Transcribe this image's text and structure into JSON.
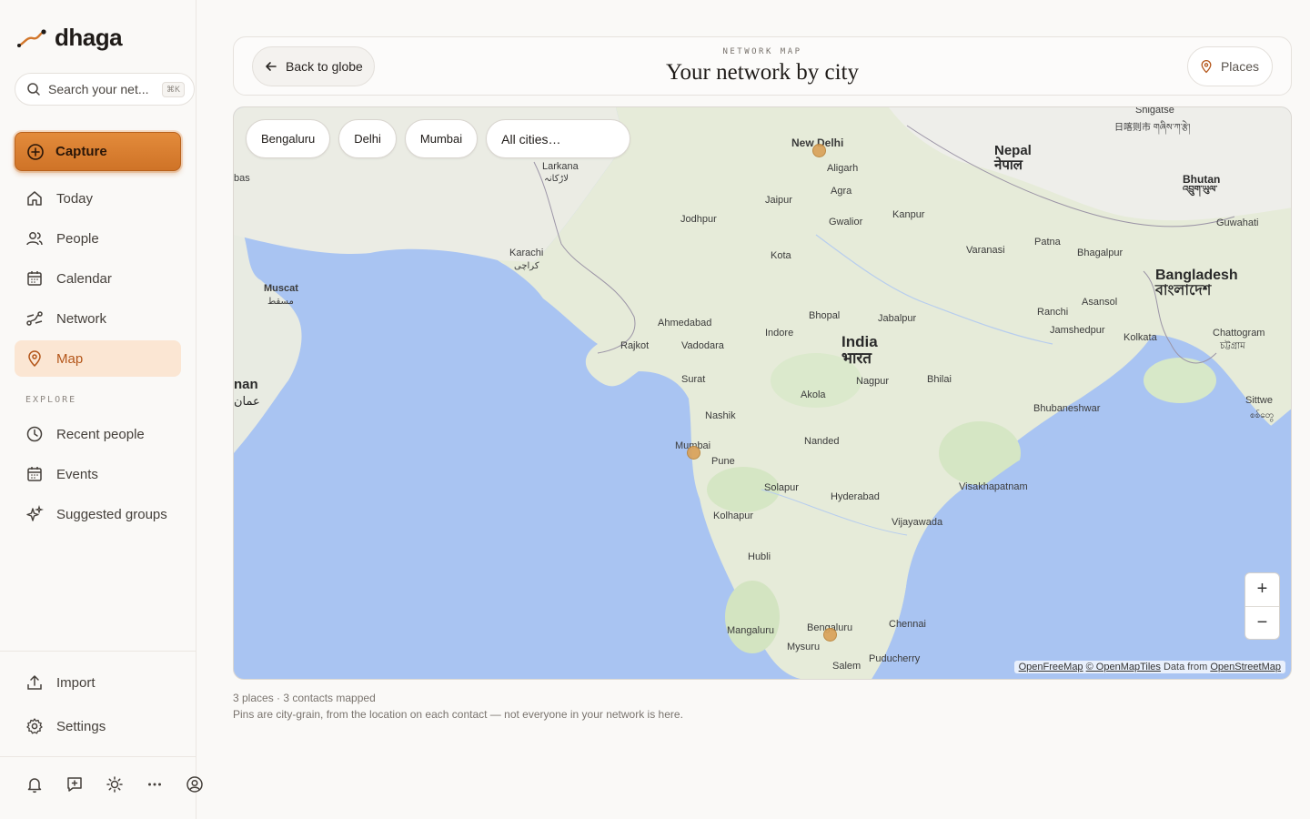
{
  "app": {
    "name": "dhaga",
    "search_placeholder": "Search your net...",
    "search_shortcut": "⌘K",
    "capture_label": "Capture"
  },
  "nav": {
    "primary": [
      {
        "label": "Today",
        "icon": "home-icon"
      },
      {
        "label": "People",
        "icon": "people-icon"
      },
      {
        "label": "Calendar",
        "icon": "calendar-icon"
      },
      {
        "label": "Network",
        "icon": "network-icon"
      },
      {
        "label": "Map",
        "icon": "map-pin-icon",
        "active": true
      }
    ],
    "explore_label": "EXPLORE",
    "explore": [
      {
        "label": "Recent people",
        "icon": "clock-icon"
      },
      {
        "label": "Events",
        "icon": "calendar-icon"
      },
      {
        "label": "Suggested groups",
        "icon": "sparkle-icon"
      }
    ],
    "bottom": [
      {
        "label": "Import",
        "icon": "upload-icon"
      },
      {
        "label": "Settings",
        "icon": "gear-icon"
      }
    ],
    "footer_icons": [
      "bell-icon",
      "message-plus-icon",
      "sun-icon",
      "more-icon",
      "account-icon"
    ]
  },
  "header": {
    "back_label": "Back to globe",
    "eyebrow": "NETWORK MAP",
    "title": "Your network by city",
    "places_label": "Places"
  },
  "map": {
    "chips": [
      "Bengaluru",
      "Delhi",
      "Mumbai"
    ],
    "city_select_value": "All cities…",
    "zoom_in": "+",
    "zoom_out": "−",
    "attribution": {
      "openfreemap": "OpenFreeMap",
      "openmaptiles": "© OpenMapTiles",
      "data_from": "Data from",
      "osm": "OpenStreetMap"
    },
    "labels": {
      "countries": [
        {
          "name": "India",
          "native": "भारत"
        },
        {
          "name": "Nepal",
          "native": "नेपाल"
        },
        {
          "name": "Bangladesh",
          "native": "বাংলাদেশ"
        },
        {
          "name": "Bhutan",
          "native": "འབྲུག་ཡུལ་"
        }
      ],
      "cities": [
        "New Delhi",
        "Aligarh",
        "Agra",
        "Jaipur",
        "Gwalior",
        "Kanpur",
        "Jodhpur",
        "Kota",
        "Varanasi",
        "Patna",
        "Bhagalpur",
        "Guwahati",
        "Shigatse",
        "日喀则市 གཞིས་ཀ་རྩེ།",
        "Larkana",
        "لاڑکانہ",
        "Karachi",
        "کراچی",
        "Muscat",
        "مسقط",
        "bas",
        "nan",
        "عمان",
        "Ahmedabad",
        "Rajkot",
        "Vadodara",
        "Indore",
        "Bhopal",
        "Jabalpur",
        "Ranchi",
        "Asansol",
        "Jamshedpur",
        "Kolkata",
        "Chattogram",
        "চট্টগ্রাম",
        "Sittwe",
        "စစ်တွေ",
        "Surat",
        "Nagpur",
        "Bhilai",
        "Akola",
        "Nashik",
        "Nanded",
        "Bhubaneshwar",
        "Mumbai",
        "Pune",
        "Solapur",
        "Hyderabad",
        "Visakhapatnam",
        "Kolhapur",
        "Vijayawada",
        "Hubli",
        "Mangaluru",
        "Bengaluru",
        "Chennai",
        "Mysuru",
        "Puducherry",
        "Salem"
      ]
    }
  },
  "summary": {
    "stats": "3 places · 3 contacts mapped",
    "note": "Pins are city-grain, from the location on each contact — not everyone in your network is here."
  }
}
